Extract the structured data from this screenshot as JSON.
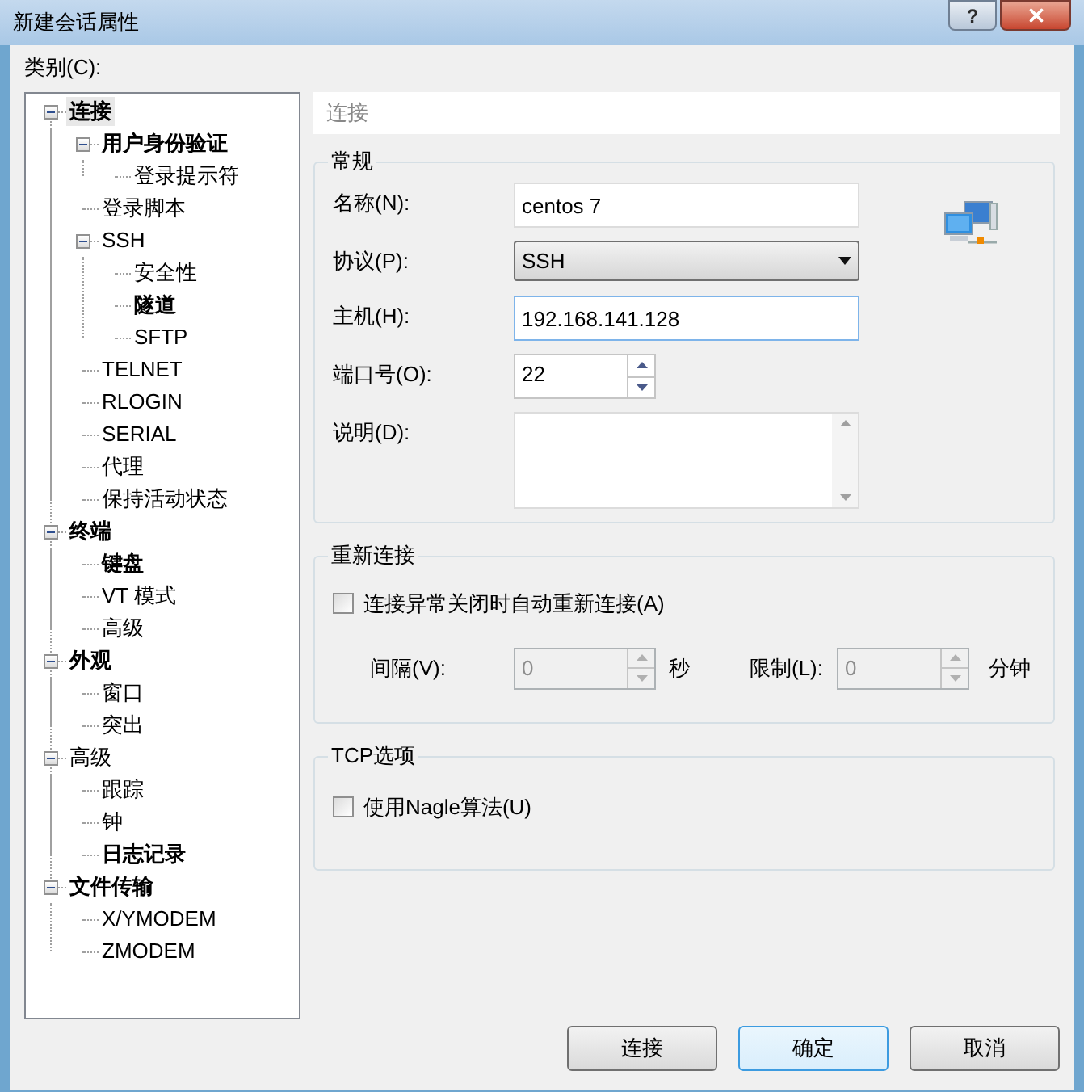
{
  "window": {
    "title": "新建会话属性",
    "help_button": "?"
  },
  "category_label": "类别(C):",
  "tree": [
    {
      "label": "连接",
      "bold": true,
      "selected": true,
      "expanded": true,
      "children": [
        {
          "label": "用户身份验证",
          "bold": true,
          "selected": false,
          "expanded": true,
          "children": [
            {
              "label": "登录提示符",
              "bold": false,
              "selected": false
            }
          ]
        },
        {
          "label": "登录脚本",
          "bold": false,
          "selected": false
        },
        {
          "label": "SSH",
          "bold": false,
          "selected": false,
          "expanded": true,
          "children": [
            {
              "label": "安全性",
              "bold": false,
              "selected": false
            },
            {
              "label": "隧道",
              "bold": true,
              "selected": false
            },
            {
              "label": "SFTP",
              "bold": false,
              "selected": false
            }
          ]
        },
        {
          "label": "TELNET",
          "bold": false,
          "selected": false
        },
        {
          "label": "RLOGIN",
          "bold": false,
          "selected": false
        },
        {
          "label": "SERIAL",
          "bold": false,
          "selected": false
        },
        {
          "label": "代理",
          "bold": false,
          "selected": false
        },
        {
          "label": "保持活动状态",
          "bold": false,
          "selected": false
        }
      ]
    },
    {
      "label": "终端",
      "bold": true,
      "selected": false,
      "expanded": true,
      "children": [
        {
          "label": "键盘",
          "bold": true,
          "selected": false
        },
        {
          "label": "VT 模式",
          "bold": false,
          "selected": false
        },
        {
          "label": "高级",
          "bold": false,
          "selected": false
        }
      ]
    },
    {
      "label": "外观",
      "bold": true,
      "selected": false,
      "expanded": true,
      "children": [
        {
          "label": "窗口",
          "bold": false,
          "selected": false
        },
        {
          "label": "突出",
          "bold": false,
          "selected": false
        }
      ]
    },
    {
      "label": "高级",
      "bold": false,
      "selected": false,
      "expanded": true,
      "children": [
        {
          "label": "跟踪",
          "bold": false,
          "selected": false
        },
        {
          "label": "钟",
          "bold": false,
          "selected": false
        },
        {
          "label": "日志记录",
          "bold": true,
          "selected": false
        }
      ]
    },
    {
      "label": "文件传输",
      "bold": true,
      "selected": false,
      "expanded": true,
      "children": [
        {
          "label": "X/YMODEM",
          "bold": false,
          "selected": false
        },
        {
          "label": "ZMODEM",
          "bold": false,
          "selected": false
        }
      ]
    }
  ],
  "page_header": "连接",
  "general": {
    "title": "常规",
    "name": {
      "label": "名称(N):",
      "value": "centos 7"
    },
    "protocol": {
      "label": "协议(P):",
      "value": "SSH"
    },
    "host": {
      "label": "主机(H):",
      "value": "192.168.141.128"
    },
    "port": {
      "label": "端口号(O):",
      "value": "22"
    },
    "description": {
      "label": "说明(D):"
    }
  },
  "reconnect": {
    "title": "重新连接",
    "auto_reconnect": {
      "label": "连接异常关闭时自动重新连接(A)",
      "checked": false
    },
    "interval": {
      "label": "间隔(V):",
      "value": "0",
      "unit": "秒",
      "disabled": true
    },
    "limit": {
      "label": "限制(L):",
      "value": "0",
      "unit": "分钟",
      "disabled": true
    }
  },
  "tcp": {
    "title": "TCP选项",
    "nagle": {
      "label": "使用Nagle算法(U)",
      "checked": false
    }
  },
  "buttons": [
    {
      "label": "连接",
      "default": false
    },
    {
      "label": "确定",
      "default": true
    },
    {
      "label": "取消",
      "default": false
    }
  ]
}
